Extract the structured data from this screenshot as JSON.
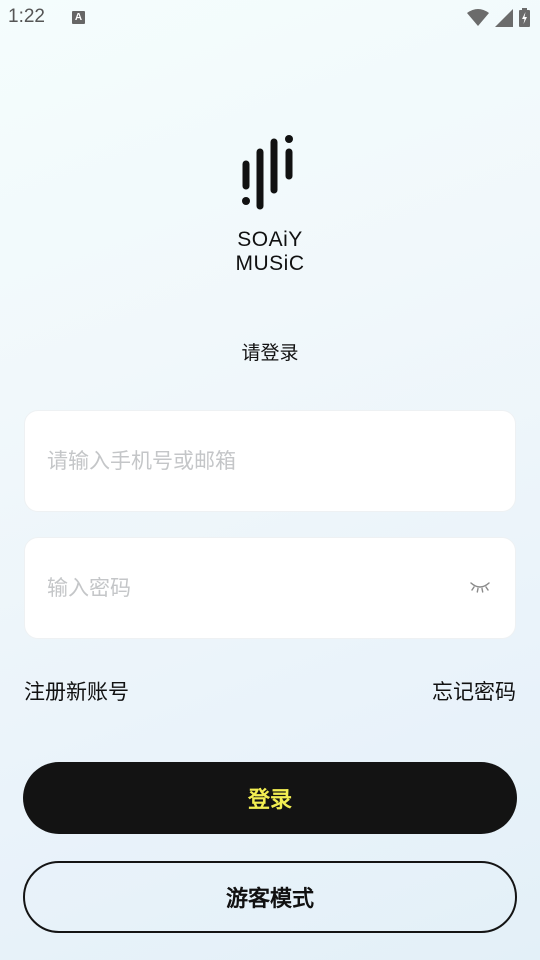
{
  "status_bar": {
    "time": "1:22",
    "notification_icon_letter": "A",
    "icons": [
      "wifi-icon",
      "signal-icon",
      "battery-charging-icon"
    ]
  },
  "logo": {
    "text": "SOAiY MUSiC"
  },
  "page": {
    "subtitle": "请登录"
  },
  "form": {
    "account_placeholder": "请输入手机号或邮箱",
    "account_value": "",
    "password_placeholder": "输入密码",
    "password_value": "",
    "password_visibility_icon": "eye-closed-icon"
  },
  "links": {
    "register": "注册新账号",
    "forgot_password": "忘记密码"
  },
  "buttons": {
    "login": "登录",
    "guest": "游客模式"
  },
  "colors": {
    "login_bg": "#131313",
    "login_text": "#f2ee52",
    "placeholder": "#c4c6c8"
  }
}
